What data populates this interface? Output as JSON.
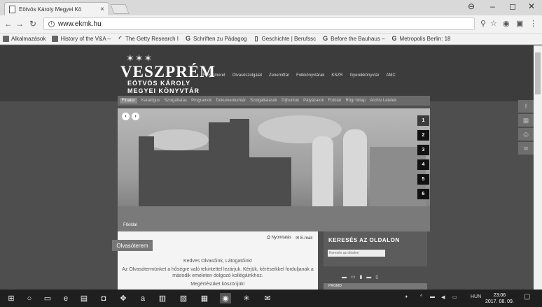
{
  "browser": {
    "tab_title": "Eötvös Károly Megyei Kö",
    "url": "www.ekmk.hu",
    "bookmarks": [
      {
        "label": "Alkalmazások",
        "icon": "apps-icon"
      },
      {
        "label": "History of the V&A –",
        "icon": "va-icon"
      },
      {
        "label": "The Getty Research I",
        "icon": "getty-icon"
      },
      {
        "label": "Schriften zu Pädagog",
        "icon": "google-icon"
      },
      {
        "label": "Geschichte | Berufssc",
        "icon": "page-icon"
      },
      {
        "label": "Before the Bauhaus –",
        "icon": "google-icon"
      },
      {
        "label": "Metropolis Berlin: 18",
        "icon": "google-icon"
      }
    ]
  },
  "site": {
    "logo": {
      "crown": "✶✶✶",
      "line1": "VESZPRÉM",
      "line2": "EÖTVÖS KÁROLY",
      "line3": "MEGYEI KÖNYVTÁR"
    },
    "topnav": [
      "Helyismeret",
      "Olvasószolgálat",
      "Zenemőtár",
      "Folkkönyvtárak",
      "KSZR",
      "Gyerekkönyvtár",
      "AMC"
    ],
    "mainnav": [
      "Finatur",
      "Katalógus",
      "Szolgáltatás",
      "Programok",
      "Dokumentumtár",
      "Szolgáltatások",
      "Dijhontok",
      "Pályázatok",
      "Fotótár",
      "Rögi hirlap",
      "Archív Leletek"
    ],
    "hero": {
      "controls": [
        "‹",
        "›"
      ],
      "caption": "Főoldal",
      "slides": [
        "1",
        "2",
        "3",
        "4",
        "5",
        "6"
      ]
    },
    "section_tab": "Olvasóterem",
    "tools": {
      "print": "Nyomtatás",
      "email": "E-mail"
    },
    "greeting": [
      "Kedves Olvasóink, Látogatóink!",
      "Az Olvasótermünket a hőségre való tekintettel lezárjuk. Kérjük, kéréseikkel forduljanak a második emeleten dolgozó kollégáinkhoz.",
      "Megértésüket köszönjük!"
    ],
    "search": {
      "title": "KERESÉS AZ OLDALON",
      "placeholder": "Keresés az oldalon"
    },
    "lang_flags": "▬ ▭ ▮ ▬ ▯",
    "side_box_label": "PROMO"
  },
  "taskbar": {
    "lang": "HUN",
    "time": "23:06",
    "date": "2017. 08. 09."
  }
}
